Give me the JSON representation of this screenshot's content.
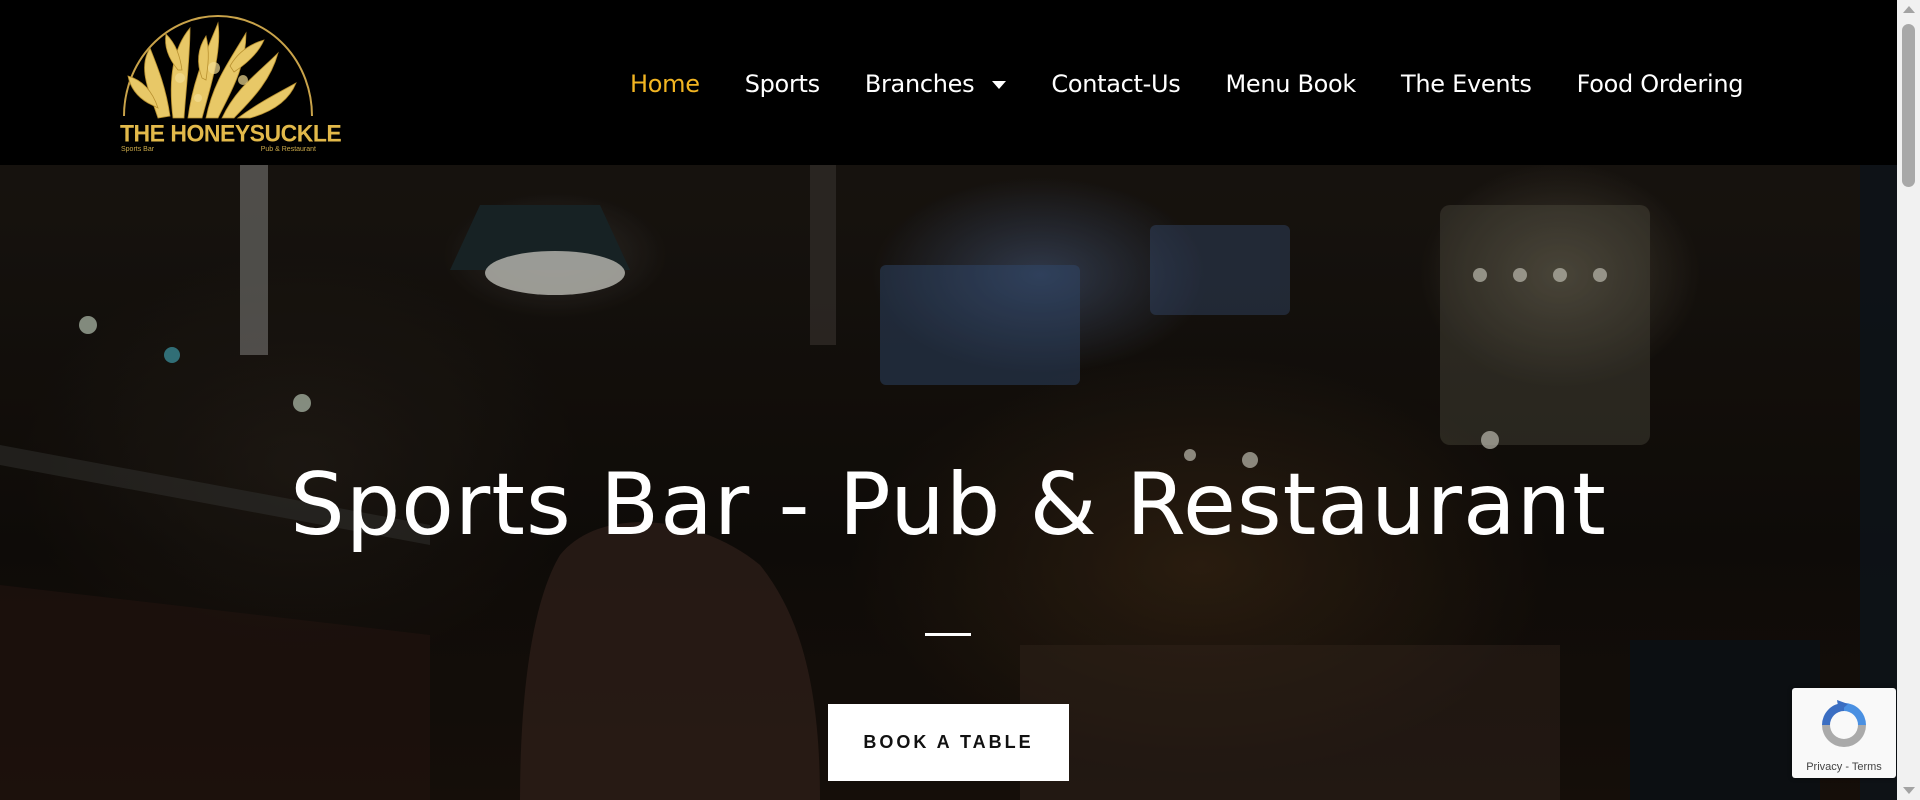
{
  "header": {
    "logo": {
      "title": "THE HONEYSUCKLE",
      "sub_left": "Sports Bar",
      "sub_right": "Pub & Restaurant",
      "color": "#e2b94a"
    },
    "nav": [
      {
        "label": "Home",
        "active": true
      },
      {
        "label": "Sports"
      },
      {
        "label": "Branches",
        "has_dropdown": true
      },
      {
        "label": "Contact-Us"
      },
      {
        "label": "Menu Book"
      },
      {
        "label": "The Events"
      },
      {
        "label": "Food Ordering"
      }
    ],
    "accent_color": "#f2b522"
  },
  "hero": {
    "title": "Sports Bar - Pub & Restaurant",
    "button_label": "BOOK A TABLE"
  },
  "recaptcha": {
    "privacy": "Privacy",
    "separator": " - ",
    "terms": "Terms"
  }
}
